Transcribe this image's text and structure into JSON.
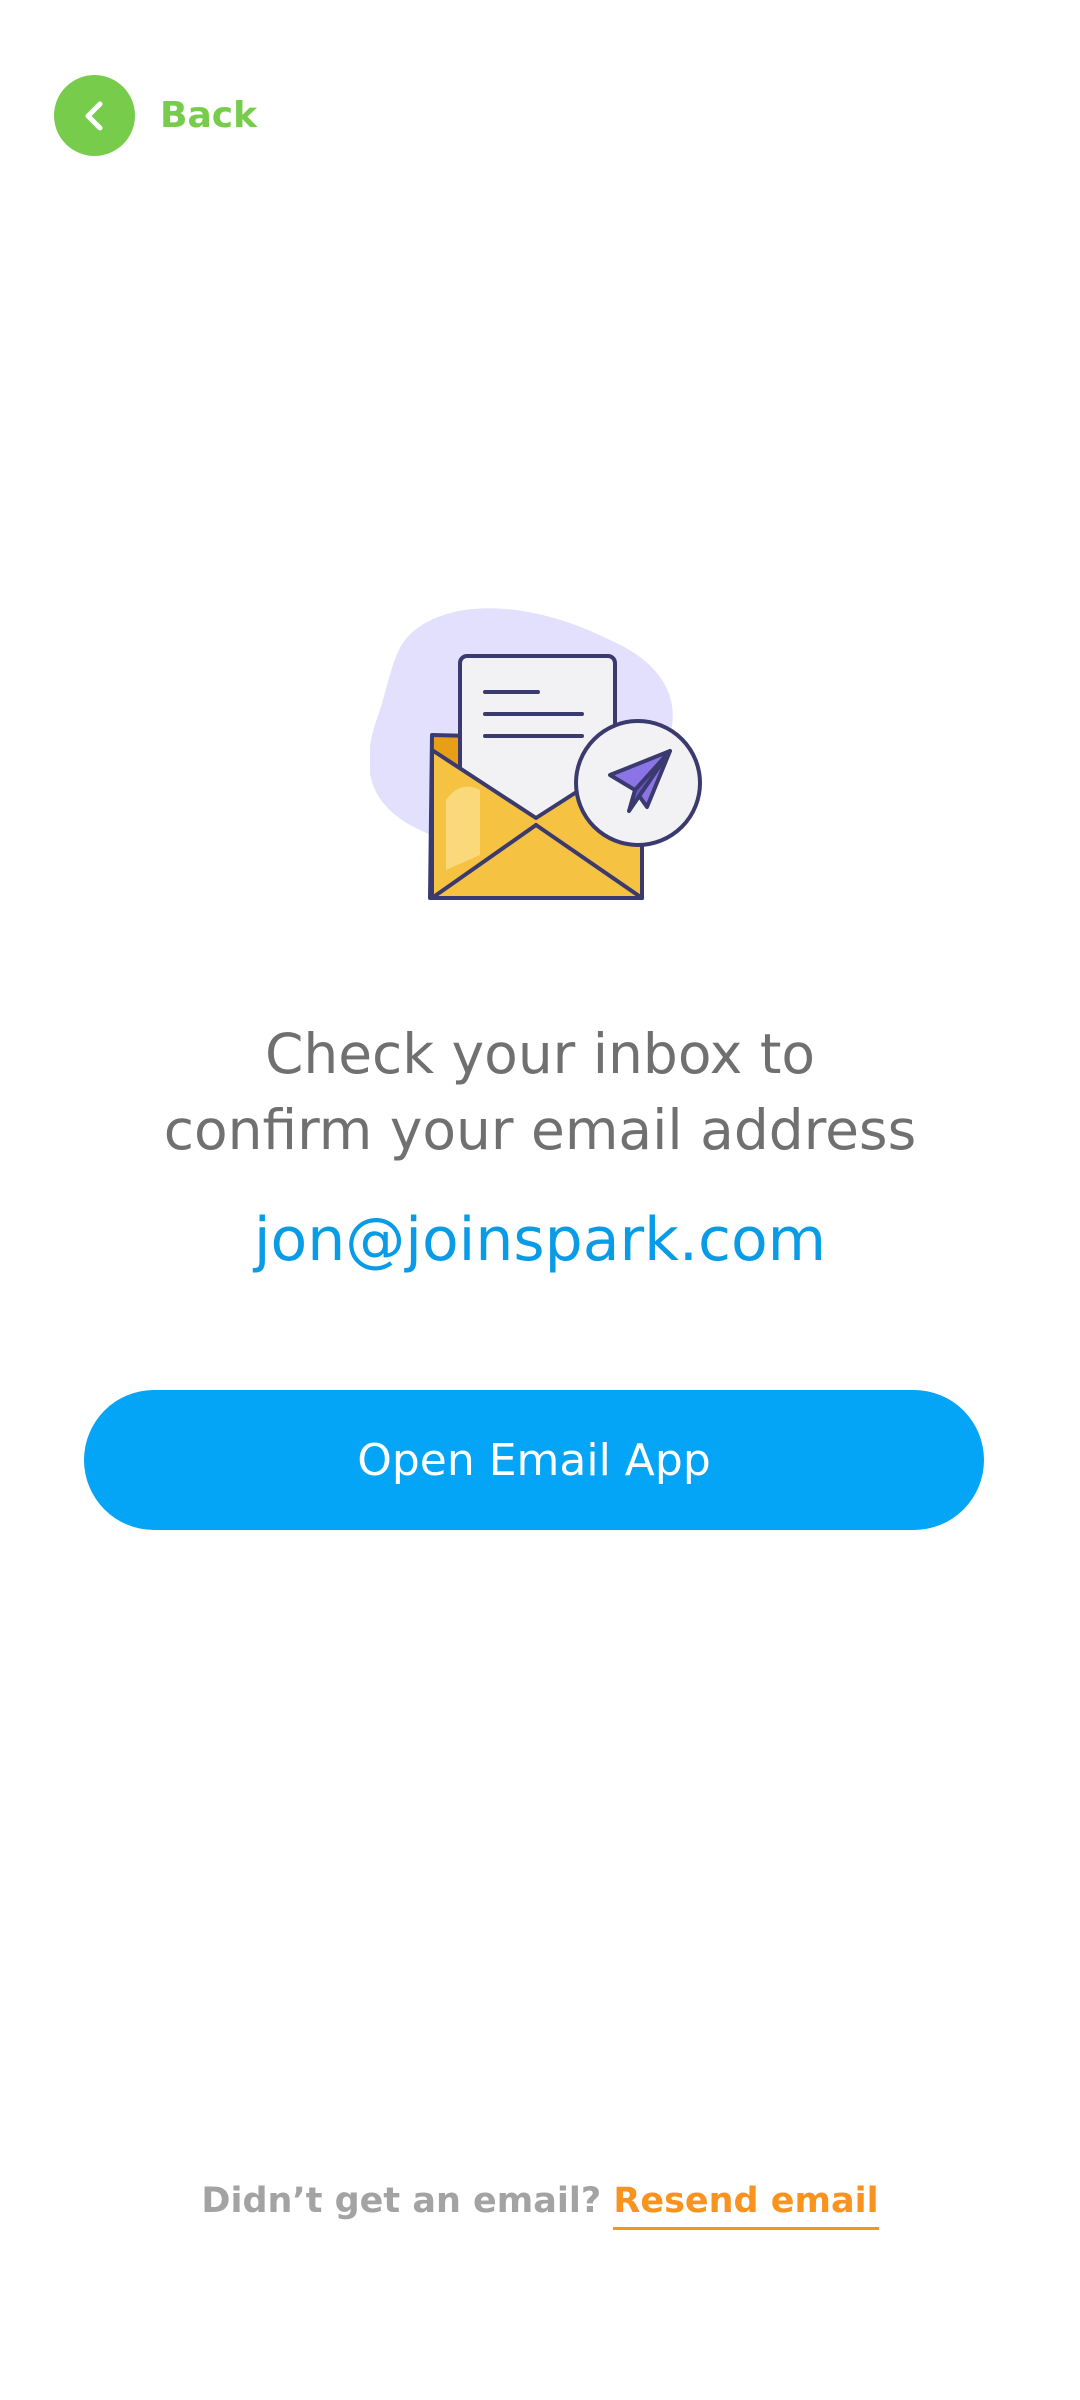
{
  "header": {
    "back_label": "Back",
    "back_icon": "chevron-left-icon"
  },
  "illustration": {
    "icon": "open-envelope-paper-plane-illustration"
  },
  "main": {
    "headline_line1": "Check your inbox to",
    "headline_line2": "confirm your email address",
    "email": "jon@joinspark.com",
    "primary_button_label": "Open Email App"
  },
  "footer": {
    "prompt": "Didn’t get an email?",
    "resend_label": "Resend email"
  },
  "colors": {
    "back_green": "#77cc4c",
    "primary_blue": "#04a4f6",
    "email_blue": "#0a9be6",
    "headline_gray": "#707070",
    "muted_gray": "#a3a3a3",
    "link_orange": "#f7931e"
  }
}
